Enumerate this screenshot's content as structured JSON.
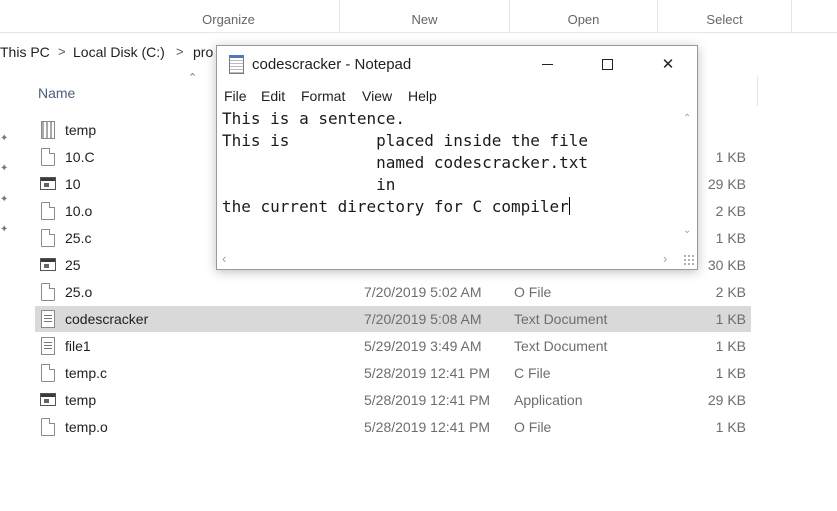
{
  "ribbon": {
    "groups": [
      "Organize",
      "New",
      "Open",
      "Select"
    ]
  },
  "address": {
    "crumbs": [
      "This PC",
      "Local Disk (C:)",
      "pro"
    ],
    "separator": ">"
  },
  "file_list": {
    "name_header": "Name",
    "rows": [
      {
        "icon": "system-file-icon",
        "name": "temp",
        "date": "",
        "type": "",
        "size": ""
      },
      {
        "icon": "document-icon",
        "name": "10.C",
        "date": "",
        "type": "",
        "size": "1 KB"
      },
      {
        "icon": "application-icon",
        "name": "10",
        "date": "",
        "type": "",
        "size": "29 KB"
      },
      {
        "icon": "document-icon",
        "name": "10.o",
        "date": "",
        "type": "",
        "size": "2 KB"
      },
      {
        "icon": "document-icon",
        "name": "25.c",
        "date": "",
        "type": "",
        "size": "1 KB"
      },
      {
        "icon": "application-icon",
        "name": "25",
        "date": "",
        "type": "",
        "size": "30 KB"
      },
      {
        "icon": "document-icon",
        "name": "25.o",
        "date": "7/20/2019 5:02 AM",
        "type": "O File",
        "size": "2 KB"
      },
      {
        "icon": "text-document-icon",
        "name": "codescracker",
        "date": "7/20/2019 5:08 AM",
        "type": "Text Document",
        "size": "1 KB",
        "selected": true
      },
      {
        "icon": "text-document-icon",
        "name": "file1",
        "date": "5/29/2019 3:49 AM",
        "type": "Text Document",
        "size": "1 KB"
      },
      {
        "icon": "document-icon",
        "name": "temp.c",
        "date": "5/28/2019 12:41 PM",
        "type": "C File",
        "size": "1 KB"
      },
      {
        "icon": "application-icon",
        "name": "temp",
        "date": "5/28/2019 12:41 PM",
        "type": "Application",
        "size": "29 KB"
      },
      {
        "icon": "document-icon",
        "name": "temp.o",
        "date": "5/28/2019 12:41 PM",
        "type": "O File",
        "size": "1 KB"
      }
    ]
  },
  "notepad": {
    "title": "codescracker - Notepad",
    "close_glyph": "✕",
    "menus": [
      "File",
      "Edit",
      "Format",
      "View",
      "Help"
    ],
    "lines": [
      "This is a sentence.",
      "This is         placed inside the file",
      "                named codescracker.txt",
      "                in",
      "the current directory for C compiler"
    ]
  },
  "colors": {
    "selection": "#d9d9d9",
    "header_text": "#4c607a",
    "detail_text": "#6d6d6d"
  }
}
